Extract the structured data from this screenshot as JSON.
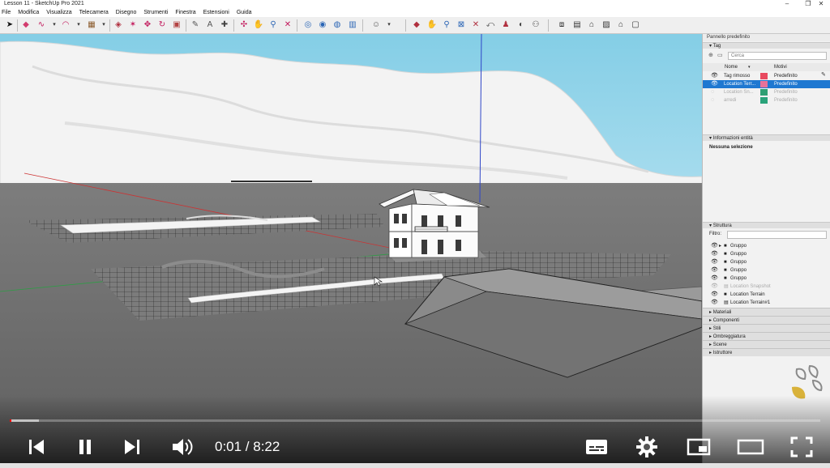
{
  "window": {
    "title": "Lesson 11 - SketchUp Pro 2021",
    "controls": [
      "–",
      "❐",
      "✕"
    ]
  },
  "menu": [
    "File",
    "Modifica",
    "Visualizza",
    "Telecamera",
    "Disegno",
    "Strumenti",
    "Finestra",
    "Estensioni",
    "Guida"
  ],
  "panel": {
    "title": "Pannello predefinito",
    "tags": {
      "header": "Tag",
      "search_placeholder": "Cerca",
      "col_name": "Nome",
      "col_pattern": "Motivi",
      "rows": [
        {
          "name": "Tag rimosso",
          "pattern": "Predefinito",
          "color": "#e8495f",
          "state": "normal",
          "eye": "👁"
        },
        {
          "name": "Location Terr...",
          "pattern": "Predefinito",
          "color": "#e8729a",
          "state": "selected",
          "eye": "👁"
        },
        {
          "name": "Location Sn...",
          "pattern": "Predefinito",
          "color": "#2e9f73",
          "state": "dim",
          "eye": "◌"
        },
        {
          "name": "arredi",
          "pattern": "Predefinito",
          "color": "#2aa37a",
          "state": "dim",
          "eye": "◌"
        }
      ]
    },
    "entity": {
      "header": "Informazioni entità",
      "text": "Nessuna selezione"
    },
    "outliner": {
      "header": "Struttura",
      "filter_label": "Filtro:",
      "rows": [
        {
          "label": "Gruppo",
          "state": "normal",
          "arrow": "▸",
          "icon": "■"
        },
        {
          "label": "Gruppo",
          "state": "normal",
          "arrow": "",
          "icon": "■"
        },
        {
          "label": "Gruppo",
          "state": "normal",
          "arrow": "",
          "icon": "■"
        },
        {
          "label": "Gruppo",
          "state": "normal",
          "arrow": "",
          "icon": "■"
        },
        {
          "label": "Gruppo",
          "state": "normal",
          "arrow": "",
          "icon": "■"
        },
        {
          "label": "Location Snapshot",
          "state": "dim",
          "arrow": "",
          "icon": "▤"
        },
        {
          "label": "Location Terrain",
          "state": "normal",
          "arrow": "",
          "icon": "■"
        },
        {
          "label": "Location Terrain#1",
          "state": "normal",
          "arrow": "",
          "icon": "▤"
        }
      ]
    },
    "collapsed_trays": [
      "Materiali",
      "Componenti",
      "Stili",
      "Ombreggiatura",
      "Scene",
      "Istruttore"
    ]
  },
  "video": {
    "time_current": "0:01",
    "time_total": "8:22",
    "time_display": "0:01 / 8:22",
    "progress_fraction": 0.002,
    "buffer_fraction": 0.036,
    "accent": "#ff0000",
    "controls": [
      "prev-icon",
      "pause-icon",
      "next-icon",
      "volume-icon",
      "subtitles-icon",
      "gear-icon",
      "miniplayer-icon",
      "theater-icon",
      "fullscreen-icon"
    ]
  },
  "colors": {
    "sky": "#8fd3e9",
    "selection": "#1f78d1"
  }
}
